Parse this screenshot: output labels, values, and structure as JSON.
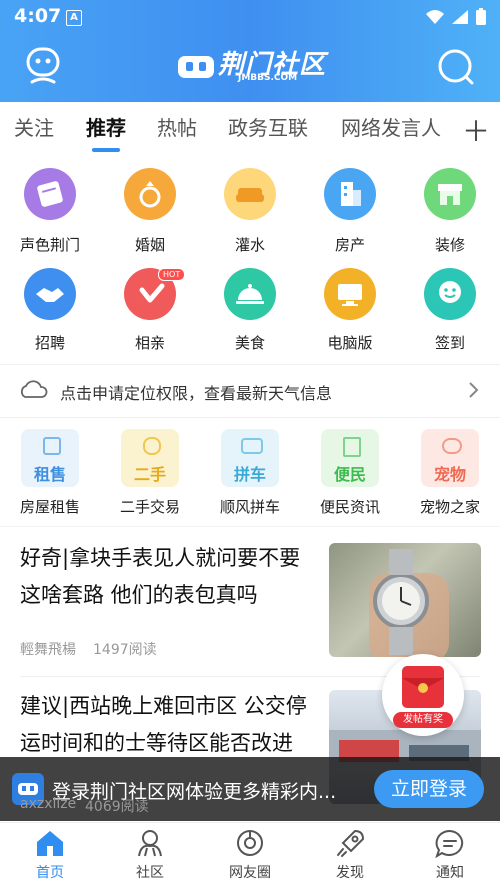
{
  "status": {
    "time": "4:07",
    "notif_badge": "A"
  },
  "header": {
    "logo_title": "荆门社区",
    "logo_sub": "JMBBS.COM"
  },
  "tabs": [
    {
      "label": "关注"
    },
    {
      "label": "推荐"
    },
    {
      "label": "热帖"
    },
    {
      "label": "政务互联"
    },
    {
      "label": "网络发言人"
    }
  ],
  "grid": [
    {
      "label": "声色荆门"
    },
    {
      "label": "婚姻"
    },
    {
      "label": "灌水"
    },
    {
      "label": "房产"
    },
    {
      "label": "装修"
    },
    {
      "label": "招聘"
    },
    {
      "label": "相亲",
      "badge": "HOT"
    },
    {
      "label": "美食"
    },
    {
      "label": "电脑版"
    },
    {
      "label": "签到"
    }
  ],
  "weather": {
    "text": "点击申请定位权限，查看最新天气信息"
  },
  "services": [
    {
      "card": "租售",
      "label": "房屋租售"
    },
    {
      "card": "二手",
      "label": "二手交易"
    },
    {
      "card": "拼车",
      "label": "顺风拼车"
    },
    {
      "card": "便民",
      "label": "便民资讯"
    },
    {
      "card": "宠物",
      "label": "宠物之家"
    }
  ],
  "articles": [
    {
      "title": "好奇|拿块手表见人就问要不要这啥套路 他们的表包真吗",
      "author": "輕舞飛楊",
      "reads": "1497阅读"
    },
    {
      "title": "建议|西站晚上难回市区 公交停运时间和的士等待区能否改进",
      "author": "axzxlize",
      "reads": "4069阅读"
    }
  ],
  "floating": {
    "label": "发帖有奖"
  },
  "banner": {
    "text": "登录荆门社区网体验更多精彩内...",
    "button": "立即登录"
  },
  "bottom_nav": [
    {
      "label": "首页"
    },
    {
      "label": "社区"
    },
    {
      "label": "网友圈"
    },
    {
      "label": "发现"
    },
    {
      "label": "通知"
    }
  ],
  "colors": {
    "brand_blue": "#3f8ff0",
    "active_nav": "#2f8ef0"
  }
}
